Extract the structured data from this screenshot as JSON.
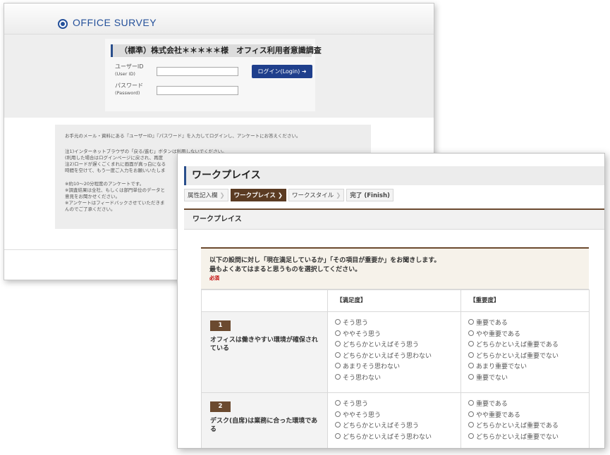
{
  "login": {
    "logo_text": "OFFICE SURVEY",
    "title": "（標準）株式会社＊＊＊＊＊様　オフィス利用者意識調査",
    "user_label": "ユーザーID",
    "user_label_en": "(User ID)",
    "password_label": "パスワード",
    "password_label_en": "(Password)",
    "login_button": "ログイン(Login) ➜",
    "notice_lines": [
      "お手元のメール・資料にある『ユーザーID』『パスワード』を入力してログインし、アンケートにお答えください。",
      "注1)インターネットブラウザの「戻る/進む」ボタンは利用しないでください。",
      "(利用した場合はログインページに戻され、再度",
      "注2)ロードが遅くごくまれに画面が真っ白になる",
      "時間を空けて、もう一度ご入力をお願いいたしま",
      "※約10〜20分程度のアンケートです。",
      "※調査結果は全社、もしくは部門単位のデータと",
      "意見をお聞かせください。",
      "※アンケートはフィードバックさせていただきま",
      "んのでご了承ください。"
    ]
  },
  "workplace": {
    "title": "ワークプレイス",
    "steps": [
      {
        "label": "属性記入欄",
        "active": false
      },
      {
        "label": "ワークプレイス",
        "active": true
      },
      {
        "label": "ワークスタイル",
        "active": false
      },
      {
        "label": "完了 (Finish)",
        "active": false
      }
    ],
    "section_title": "ワークプレイス",
    "intro_line1": "以下の設問に対し「現在満足しているか」「その項目が重要か」をお聞きします。",
    "intro_line2": "最もよくあてはまると思うものを選択してください。",
    "required_label": "必須",
    "col_satisfaction": "【満足度】",
    "col_importance": "【重要度】",
    "questions": [
      {
        "number": "1",
        "text": "オフィスは働きやすい環境が確保されている",
        "satisfaction_options": [
          "そう思う",
          "ややそう思う",
          "どちらかといえばそう思う",
          "どちらかといえばそう思わない",
          "あまりそう思わない",
          "そう思わない"
        ],
        "importance_options": [
          "重要である",
          "やや重要である",
          "どちらかといえば重要である",
          "どちらかといえば重要でない",
          "あまり重要でない",
          "重要でない"
        ]
      },
      {
        "number": "2",
        "text": "デスク(自席)は業務に合った環境である",
        "satisfaction_options": [
          "そう思う",
          "ややそう思う",
          "どちらかといえばそう思う",
          "どちらかといえばそう思わない"
        ],
        "importance_options": [
          "重要である",
          "やや重要である",
          "どちらかといえば重要である",
          "どちらかといえば重要でない"
        ]
      }
    ]
  }
}
